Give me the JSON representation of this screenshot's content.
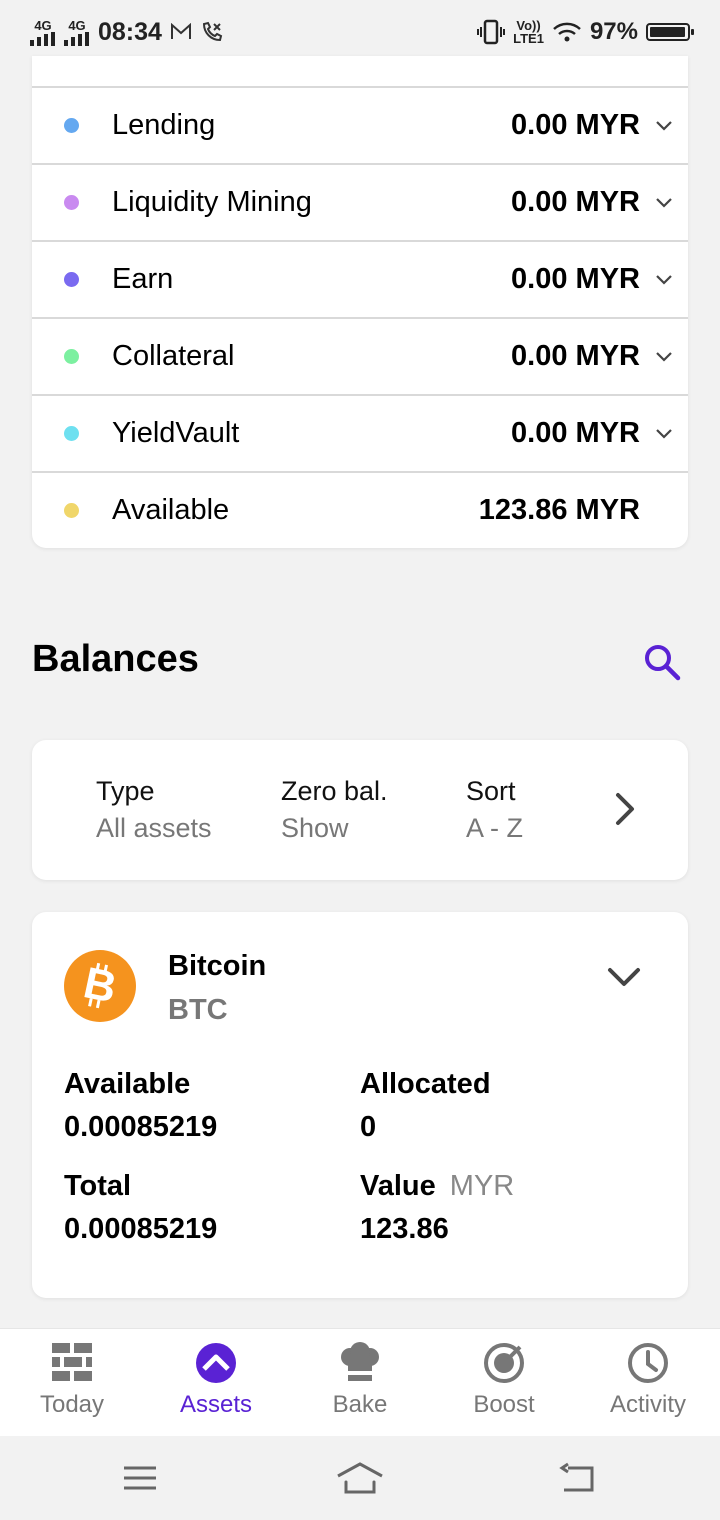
{
  "status_bar": {
    "network1": "4G",
    "network2": "4G",
    "time": "08:34",
    "volte": "Vo))",
    "lte": "LTE1",
    "battery": "97%",
    "battery_level": 0.97
  },
  "allocations": [
    {
      "label": "Lending",
      "value": "0.00 MYR",
      "color": "#64a8f0",
      "expandable": true
    },
    {
      "label": "Liquidity Mining",
      "value": "0.00 MYR",
      "color": "#c98af0",
      "expandable": true
    },
    {
      "label": "Earn",
      "value": "0.00 MYR",
      "color": "#7a6af0",
      "expandable": true
    },
    {
      "label": "Collateral",
      "value": "0.00 MYR",
      "color": "#7cf0a0",
      "expandable": true
    },
    {
      "label": "YieldVault",
      "value": "0.00 MYR",
      "color": "#6ee0f0",
      "expandable": true
    },
    {
      "label": "Available",
      "value": "123.86 MYR",
      "color": "#f0d66a",
      "expandable": false
    }
  ],
  "balances": {
    "title": "Balances",
    "filters": [
      {
        "key": "Type",
        "value": "All assets"
      },
      {
        "key": "Zero bal.",
        "value": "Show"
      },
      {
        "key": "Sort",
        "value": "A - Z"
      }
    ]
  },
  "asset": {
    "name": "Bitcoin",
    "symbol": "BTC",
    "available_label": "Available",
    "available_value": "0.00085219",
    "allocated_label": "Allocated",
    "allocated_value": "0",
    "total_label": "Total",
    "total_value": "0.00085219",
    "value_label": "Value",
    "value_unit": "MYR",
    "value_value": "123.86"
  },
  "bottom_nav": [
    {
      "label": "Today",
      "icon": "bricks-icon",
      "active": false
    },
    {
      "label": "Assets",
      "icon": "assets-icon",
      "active": true
    },
    {
      "label": "Bake",
      "icon": "chef-hat-icon",
      "active": false
    },
    {
      "label": "Boost",
      "icon": "boost-icon",
      "active": false
    },
    {
      "label": "Activity",
      "icon": "clock-icon",
      "active": false
    }
  ],
  "colors": {
    "accent": "#5a22d4",
    "bitcoin": "#f5931e"
  }
}
